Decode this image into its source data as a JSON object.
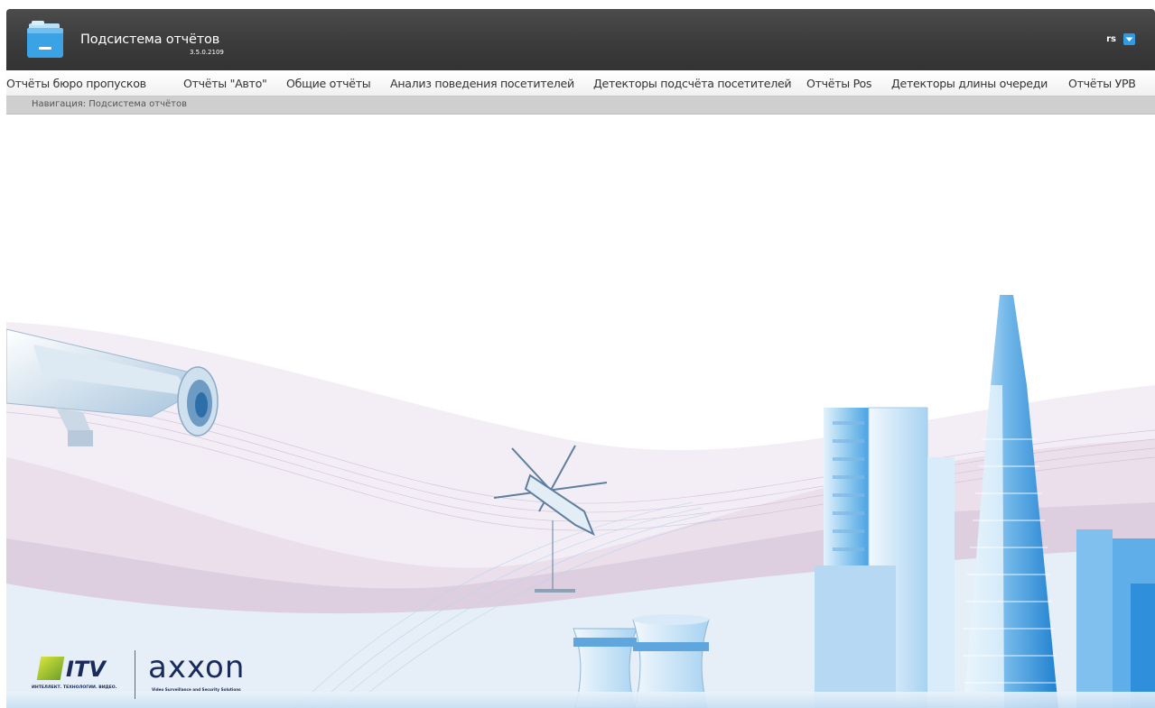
{
  "header": {
    "app_title": "Подсистема отчётов",
    "version": "3.5.0.2109",
    "user_name": "rs",
    "icon": "folder-reports-icon",
    "dropdown_icon": "chevron-down-icon"
  },
  "menu": {
    "items": [
      {
        "label": "Отчёты бюро пропусков"
      },
      {
        "label": "Отчёты \"Авто\""
      },
      {
        "label": "Общие отчёты"
      },
      {
        "label": "Анализ поведения посетителей"
      },
      {
        "label": "Детекторы подсчёта посетителей"
      },
      {
        "label": "Отчёты Pos"
      },
      {
        "label": "Детекторы длины очереди"
      },
      {
        "label": "Отчёты УРВ"
      }
    ]
  },
  "breadcrumb": {
    "text": "Навигация: Подсистема отчётов"
  },
  "banner": {
    "logo_itv": "ITV",
    "logo_itv_caption": "ИНТЕЛЛЕКТ. ТЕХНОЛОГИИ. ВИДЕО.",
    "logo_axxon": "axxon",
    "logo_axxon_caption": "Video Surveillance and Security Solutions"
  },
  "colors": {
    "header_bg": "#3a3a3a",
    "accent": "#2f9be3",
    "menu_text": "#333333",
    "breadcrumb_bg": "#cfcfcf"
  }
}
